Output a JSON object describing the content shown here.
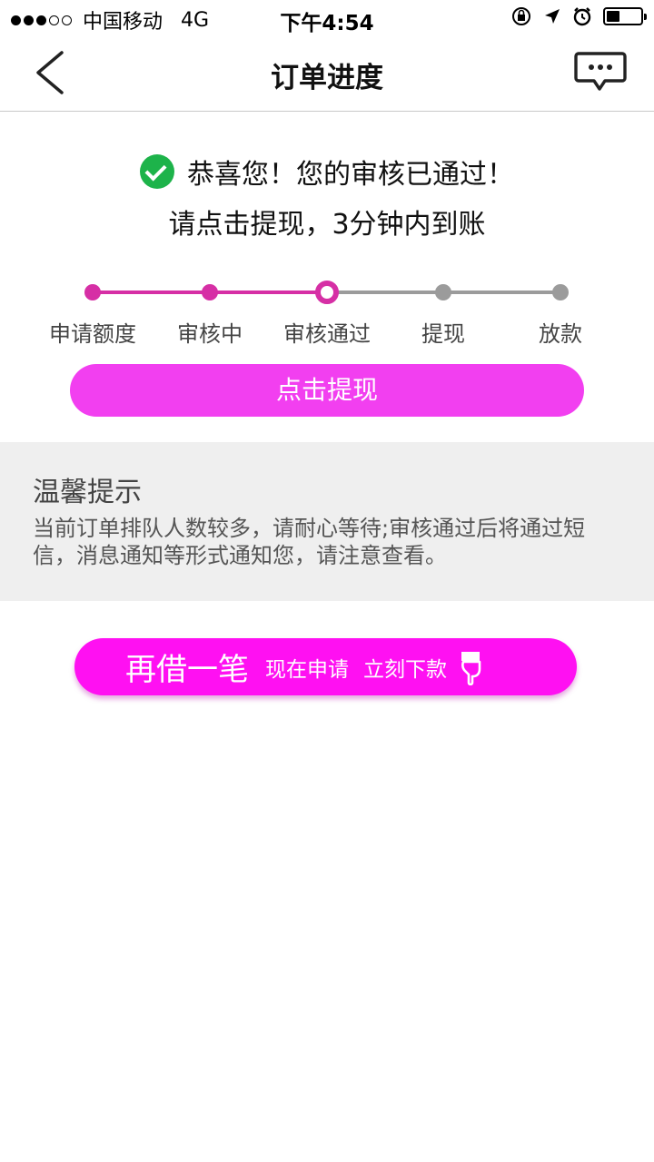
{
  "status_bar": {
    "carrier": "中国移动",
    "network": "4G",
    "time": "下午4:54"
  },
  "nav": {
    "title": "订单进度"
  },
  "success": {
    "line1": "恭喜您！您的审核已通过！",
    "line2": "请点击提现，3分钟内到账"
  },
  "progress": {
    "current_step": 3,
    "steps": [
      {
        "label": "申请额度",
        "state": "done"
      },
      {
        "label": "审核中",
        "state": "done"
      },
      {
        "label": "审核通过",
        "state": "current"
      },
      {
        "label": "提现",
        "state": "todo"
      },
      {
        "label": "放款",
        "state": "todo"
      }
    ]
  },
  "actions": {
    "withdraw_label": "点击提现"
  },
  "tips": {
    "title": "温馨提示",
    "body": "当前订单排队人数较多，请耐心等待;审核通过后将通过短信，消息通知等形式通知您，请注意查看。"
  },
  "borrow": {
    "main_label": "再借一笔",
    "sub_label_1": "现在申请",
    "sub_label_2": "立刻下款"
  },
  "colors": {
    "accent": "#d62fa5",
    "withdraw_button": "#f23ff0",
    "borrow_button": "#ff10f2",
    "success_green": "#1db34a",
    "inactive_gray": "#9b9b9b"
  },
  "icons": {
    "back": "chevron-left-icon",
    "message": "chat-bubble-icon",
    "success": "check-circle-icon",
    "hand": "pointing-hand-icon"
  }
}
